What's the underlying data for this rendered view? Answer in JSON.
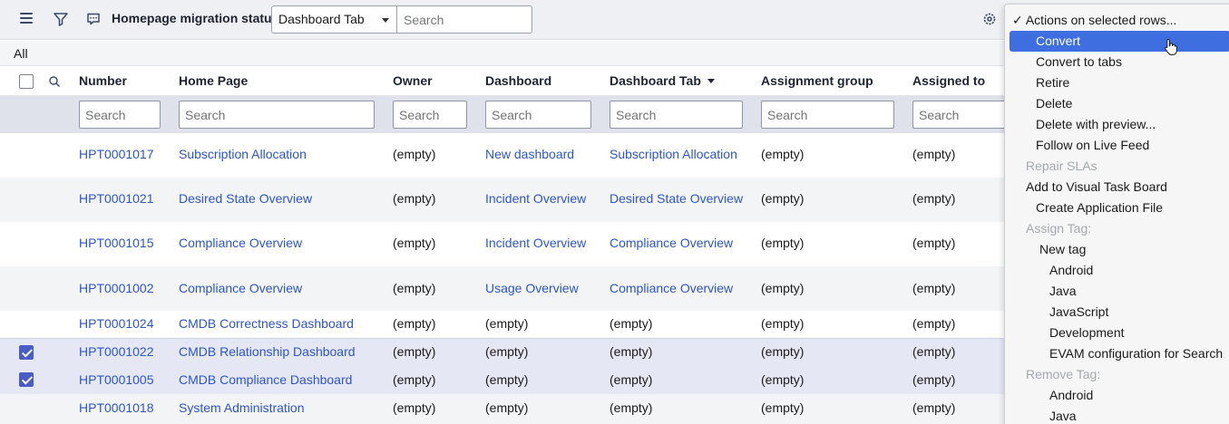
{
  "header": {
    "title": "Homepage migration status",
    "field_select": "Dashboard Tab",
    "search_placeholder": "Search"
  },
  "breadcrumb": {
    "label": "All"
  },
  "columns": [
    "Number",
    "Home Page",
    "Owner",
    "Dashboard",
    "Dashboard Tab",
    "Assignment group",
    "Assigned to"
  ],
  "filter_placeholder": "Search",
  "rows": [
    {
      "number": "HPT0001017",
      "home_page": "Subscription Allocation",
      "owner": "(empty)",
      "dashboard": "New dashboard",
      "dashboard_tab": "Subscription Allocation",
      "assignment_group": "(empty)",
      "assigned_to": "(empty)",
      "checked": false
    },
    {
      "number": "HPT0001021",
      "home_page": "Desired State Overview",
      "owner": "(empty)",
      "dashboard": "Incident Overview",
      "dashboard_tab": "Desired State Overview",
      "assignment_group": "(empty)",
      "assigned_to": "(empty)",
      "checked": false
    },
    {
      "number": "HPT0001015",
      "home_page": "Compliance Overview",
      "owner": "(empty)",
      "dashboard": "Incident Overview",
      "dashboard_tab": "Compliance Overview",
      "assignment_group": "(empty)",
      "assigned_to": "(empty)",
      "checked": false
    },
    {
      "number": "HPT0001002",
      "home_page": "Compliance Overview",
      "owner": "(empty)",
      "dashboard": "Usage Overview",
      "dashboard_tab": "Compliance Overview",
      "assignment_group": "(empty)",
      "assigned_to": "(empty)",
      "checked": false
    },
    {
      "number": "HPT0001024",
      "home_page": "CMDB Correctness Dashboard",
      "owner": "(empty)",
      "dashboard": "(empty)",
      "dashboard_tab": "(empty)",
      "assignment_group": "(empty)",
      "assigned_to": "(empty)",
      "checked": false
    },
    {
      "number": "HPT0001022",
      "home_page": "CMDB Relationship Dashboard",
      "owner": "(empty)",
      "dashboard": "(empty)",
      "dashboard_tab": "(empty)",
      "assignment_group": "(empty)",
      "assigned_to": "(empty)",
      "checked": true
    },
    {
      "number": "HPT0001005",
      "home_page": "CMDB Compliance Dashboard",
      "owner": "(empty)",
      "dashboard": "(empty)",
      "dashboard_tab": "(empty)",
      "assignment_group": "(empty)",
      "assigned_to": "(empty)",
      "checked": true
    },
    {
      "number": "HPT0001018",
      "home_page": "System Administration",
      "owner": "(empty)",
      "dashboard": "(empty)",
      "dashboard_tab": "(empty)",
      "assignment_group": "(empty)",
      "assigned_to": "(empty)",
      "checked": false
    }
  ],
  "menu": {
    "items": [
      {
        "label": "✓ Actions on selected rows...",
        "state": "checked"
      },
      {
        "label": "Convert",
        "state": "active"
      },
      {
        "label": "Convert to tabs",
        "state": "normal"
      },
      {
        "label": "Retire",
        "state": "normal"
      },
      {
        "label": "Delete",
        "state": "normal"
      },
      {
        "label": "Delete with preview...",
        "state": "normal"
      },
      {
        "label": "Follow on Live Feed",
        "state": "normal"
      },
      {
        "label": "Repair SLAs",
        "state": "disabled"
      },
      {
        "label": "Add to Visual Task Board",
        "state": "normal"
      },
      {
        "label": "Create Application File",
        "state": "normal"
      },
      {
        "label": "Assign Tag:",
        "state": "disabled"
      },
      {
        "label": "New tag",
        "state": "normal"
      },
      {
        "label": "Android",
        "state": "normal"
      },
      {
        "label": "Java",
        "state": "normal"
      },
      {
        "label": "JavaScript",
        "state": "normal"
      },
      {
        "label": "Development",
        "state": "normal"
      },
      {
        "label": "EVAM configuration for Search",
        "state": "normal"
      },
      {
        "label": "Remove Tag:",
        "state": "disabled"
      },
      {
        "label": "Android",
        "state": "normal"
      },
      {
        "label": "Java",
        "state": "normal"
      }
    ]
  },
  "colors": {
    "link": "#2d56c6",
    "menu_active": "#3e6ee0",
    "checkbox_checked": "#4a5cc6",
    "selected_row": "#e5e7f5"
  }
}
